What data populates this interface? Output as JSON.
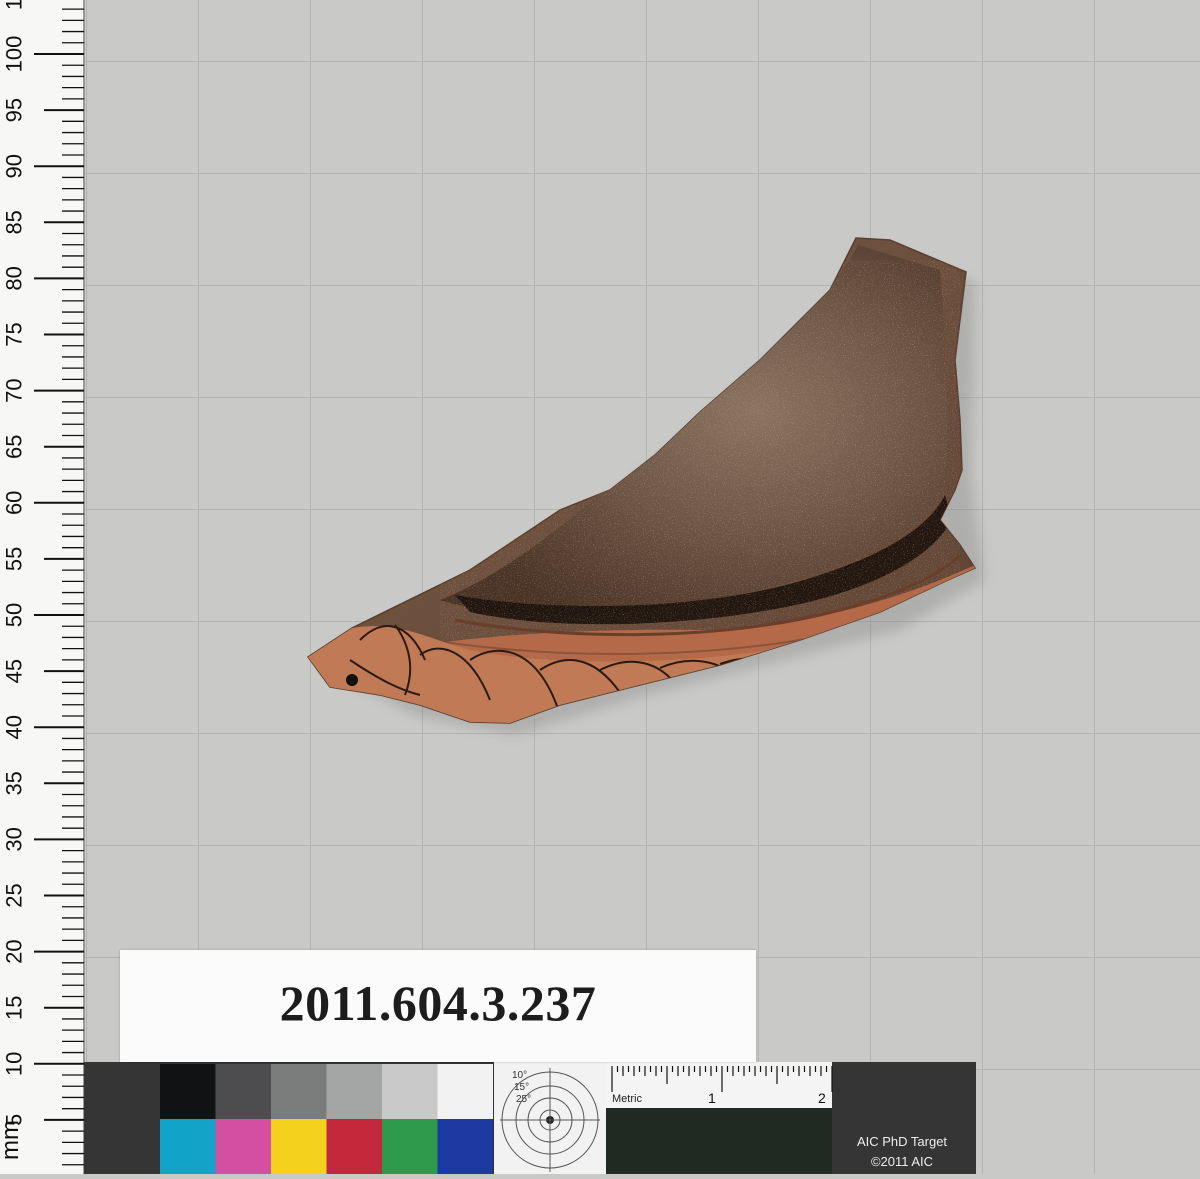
{
  "photo": {
    "subject": "terracotta pottery fragment",
    "background_color": "#c9c9c7",
    "grid_color": "#b3b4b2"
  },
  "ruler": {
    "unit": "mm",
    "labels": [
      "5",
      "10",
      "15",
      "20",
      "25",
      "30",
      "35",
      "40",
      "45",
      "50",
      "55",
      "60",
      "65",
      "70",
      "75",
      "80",
      "85",
      "90",
      "95",
      "100",
      "10"
    ]
  },
  "accession": {
    "number": "2011.604.3.237"
  },
  "color_target": {
    "gray_swatches": [
      "#111214",
      "#4d4d4f",
      "#7a7b7b",
      "#a4a5a5",
      "#c9c9c9",
      "#f2f2f2"
    ],
    "color_swatches": [
      "#11a3c8",
      "#d44ea1",
      "#f2d21d",
      "#c3283b",
      "#2f9a4b",
      "#1d3aa2"
    ],
    "dial_labels": [
      "10°",
      "15°",
      "25°"
    ],
    "scale_label": "Metric",
    "scale_numbers": [
      "1",
      "2"
    ],
    "title": "AIC PhD Target",
    "copyright": "©2011 AIC"
  }
}
